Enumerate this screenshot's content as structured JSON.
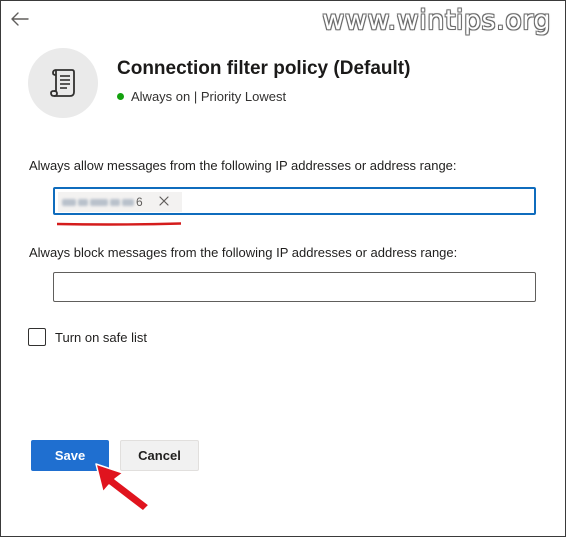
{
  "watermark": {
    "text": "www.wintips.org"
  },
  "header": {
    "back_icon": "arrow-left-icon",
    "policy_icon": "scroll-icon",
    "title": "Connection filter policy (Default)",
    "status_text": "Always on | Priority Lowest",
    "status_color": "#13a10e"
  },
  "allow_field": {
    "label": "Always allow messages from the following IP addresses or address range:",
    "chip_visible_suffix": "6",
    "chip_remove_icon": "close-icon",
    "highlight_color": "#d41c1c"
  },
  "block_field": {
    "label": "Always block messages from the following IP addresses or address range:",
    "value": ""
  },
  "safe_list": {
    "label": "Turn on safe list",
    "checked": false
  },
  "footer": {
    "save_label": "Save",
    "cancel_label": "Cancel",
    "accent_color": "#1f6fd0",
    "arrow_color": "#e0141e"
  }
}
